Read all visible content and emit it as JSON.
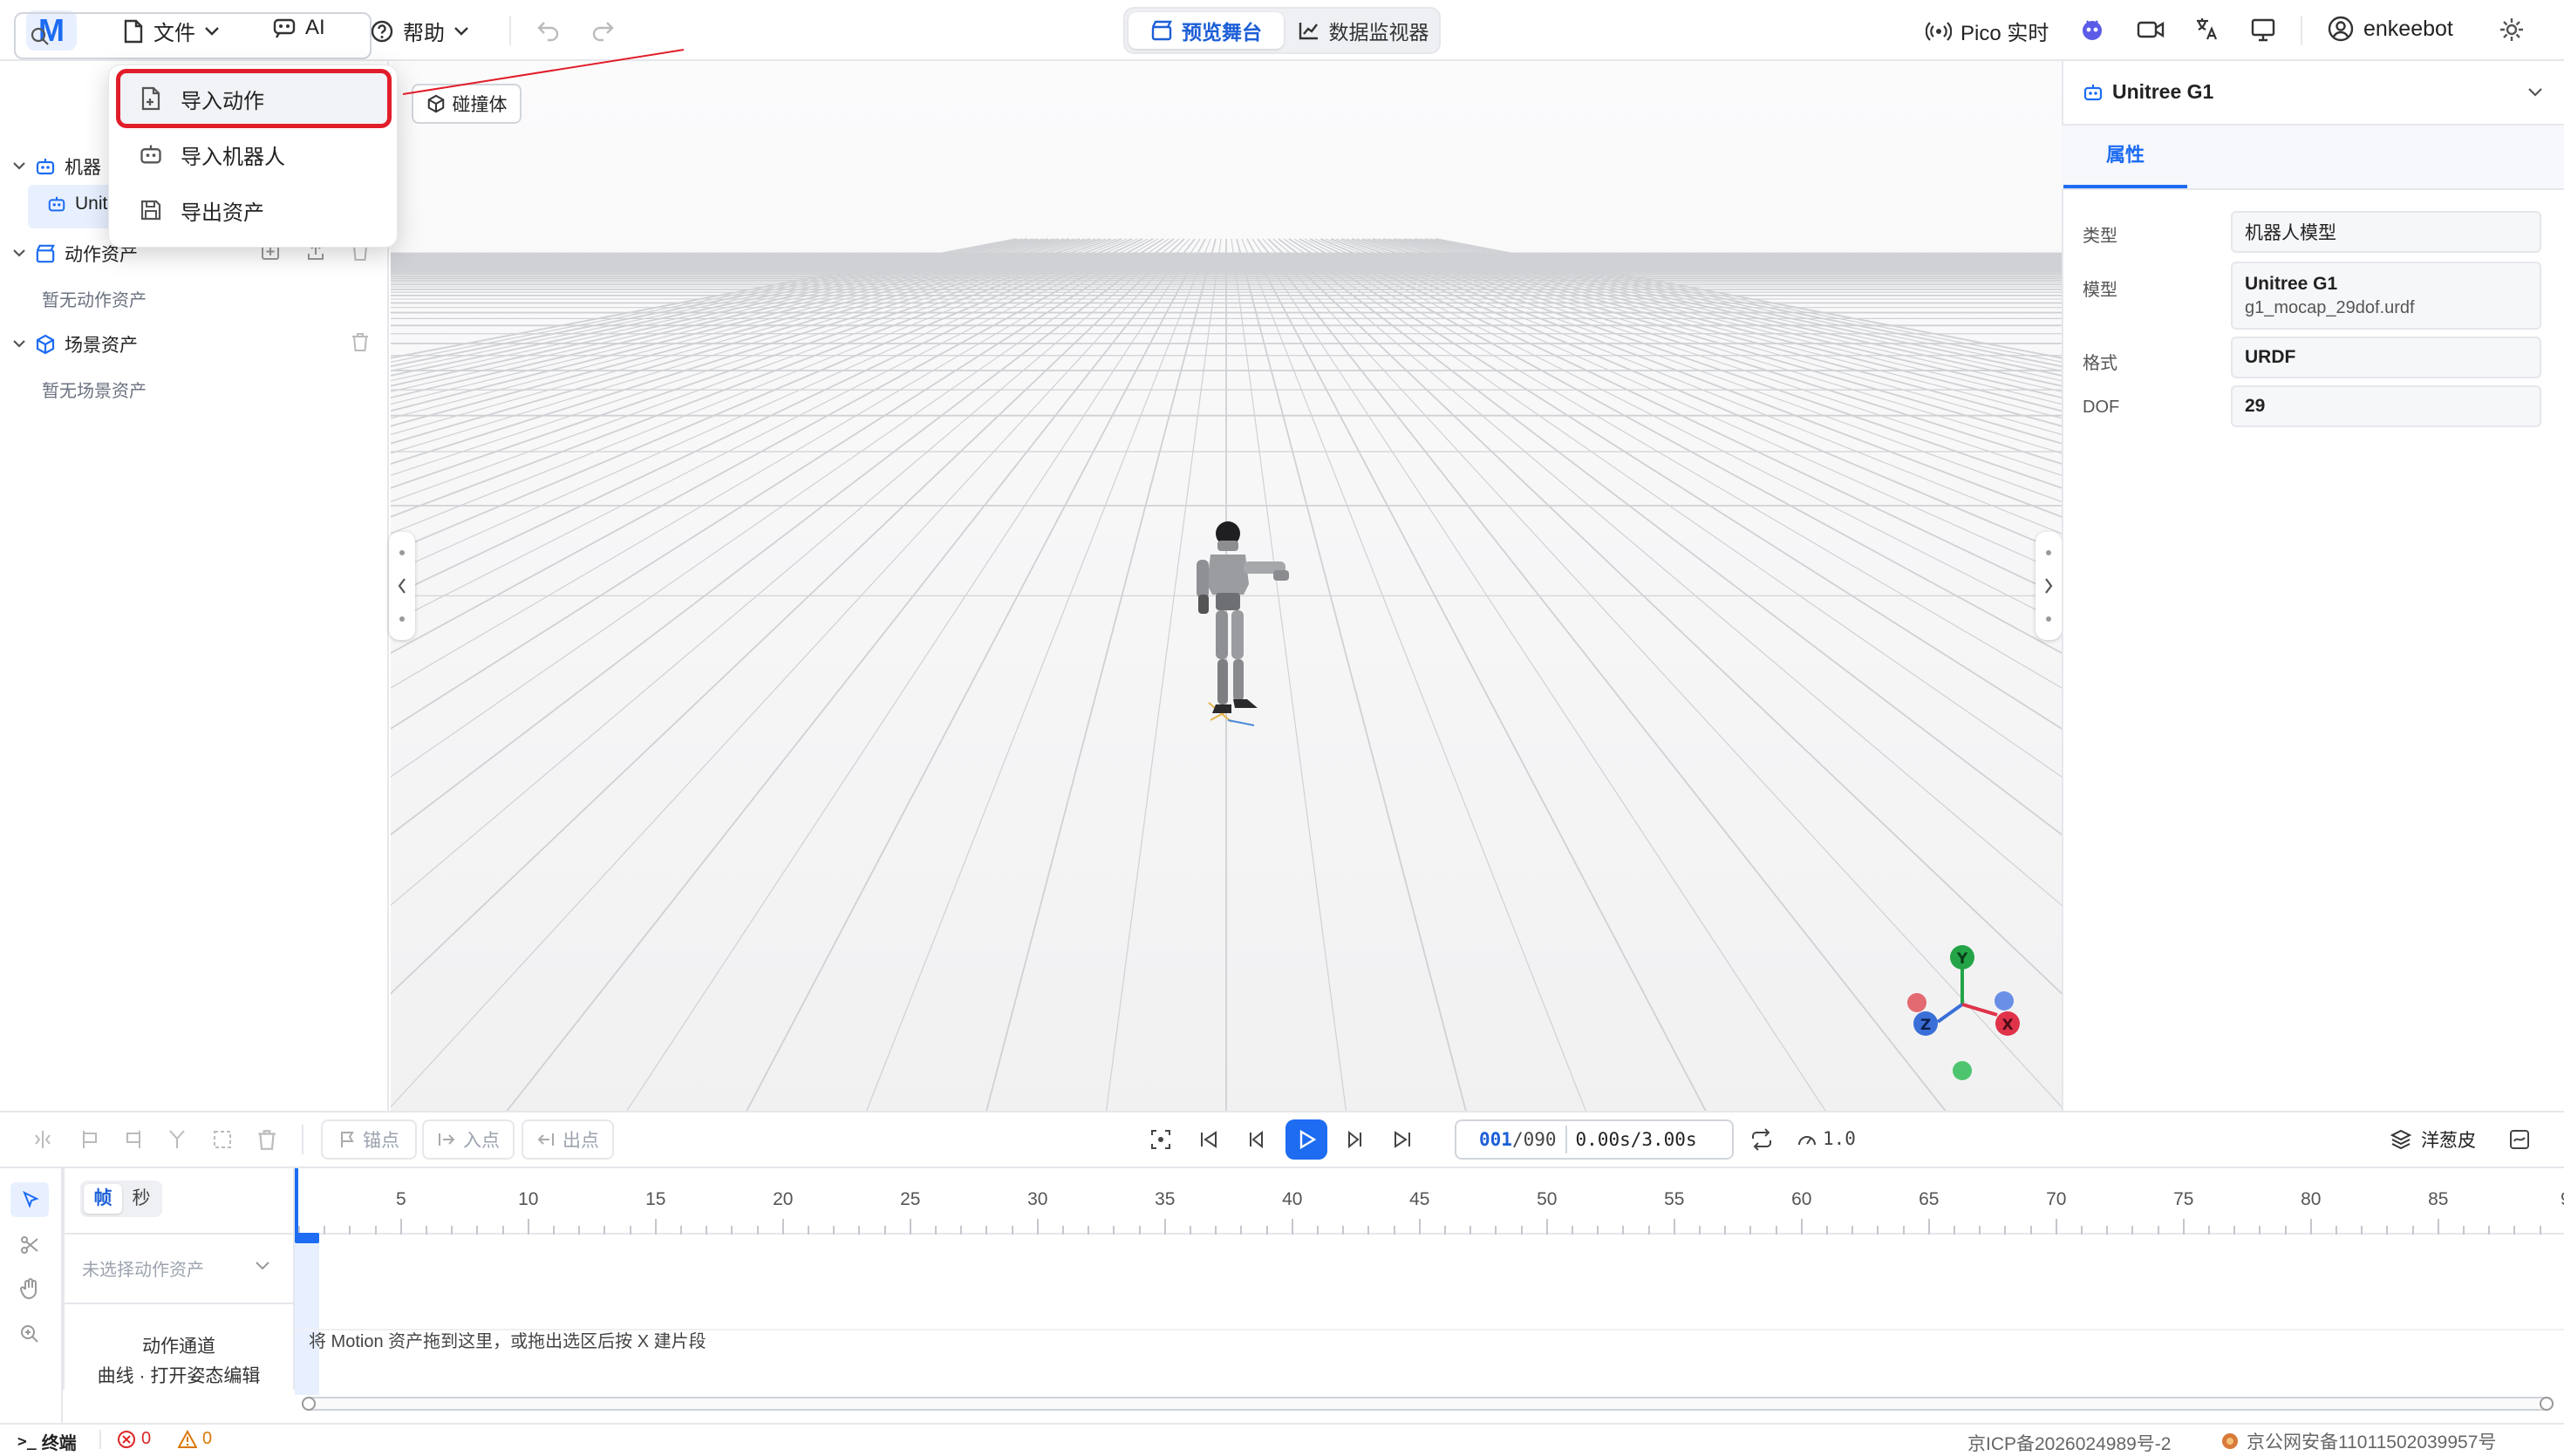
{
  "app": {
    "logo_letter": "M",
    "accent": "#1d6cf2"
  },
  "menubar": {
    "file": "文件",
    "ai": "AI",
    "help": "帮助"
  },
  "views": {
    "preview": "预览舞台",
    "monitor": "数据监视器"
  },
  "right_toolbar": {
    "pico": "Pico 实时",
    "user": "enkeebot"
  },
  "file_menu": {
    "items": [
      {
        "label": "导入动作",
        "icon": "file-import-icon"
      },
      {
        "label": "导入机器人",
        "icon": "robot-icon"
      },
      {
        "label": "导出资产",
        "icon": "save-icon"
      }
    ]
  },
  "left_panel": {
    "robots_label": "机器",
    "robot_item": "Unit",
    "motion_label": "动作资产",
    "motion_empty": "暂无动作资产",
    "scene_label": "场景资产",
    "scene_empty": "暂无场景资产"
  },
  "viewport": {
    "collider_btn": "碰撞体",
    "axes": {
      "y": "Y",
      "z": "Z",
      "x": "X"
    }
  },
  "properties": {
    "title": "Unitree G1",
    "tab": "属性",
    "type_label": "类型",
    "type_value": "机器人模型",
    "model_label": "模型",
    "model_name": "Unitree G1",
    "model_file": "g1_mocap_29dof.urdf",
    "format_label": "格式",
    "format_value": "URDF",
    "dof_label": "DOF",
    "dof_value": "29"
  },
  "timeline": {
    "anchor": "锚点",
    "in": "入点",
    "out": "出点",
    "frame_current": "001",
    "frame_total": "/090",
    "time": "0.00s/3.00s",
    "speed": "1.0",
    "onion": "洋葱皮",
    "unit_frame": "帧",
    "unit_sec": "秒",
    "ticks": [
      "5",
      "10",
      "15",
      "20",
      "25",
      "30",
      "35",
      "40",
      "45",
      "50",
      "55",
      "60",
      "65",
      "70",
      "75",
      "80",
      "85",
      "9"
    ],
    "asset_select": "未选择动作资产",
    "channel_title": "动作通道",
    "channel_sub": "曲线 · 打开姿态编辑",
    "drop_hint": "将 Motion 资产拖到这里，或拖出选区后按 X 建片段"
  },
  "statusbar": {
    "terminal": "终端",
    "errors": "0",
    "warnings": "0",
    "icp": "京ICP备2026024989号-2",
    "police": "京公网安备11011502039957号"
  }
}
